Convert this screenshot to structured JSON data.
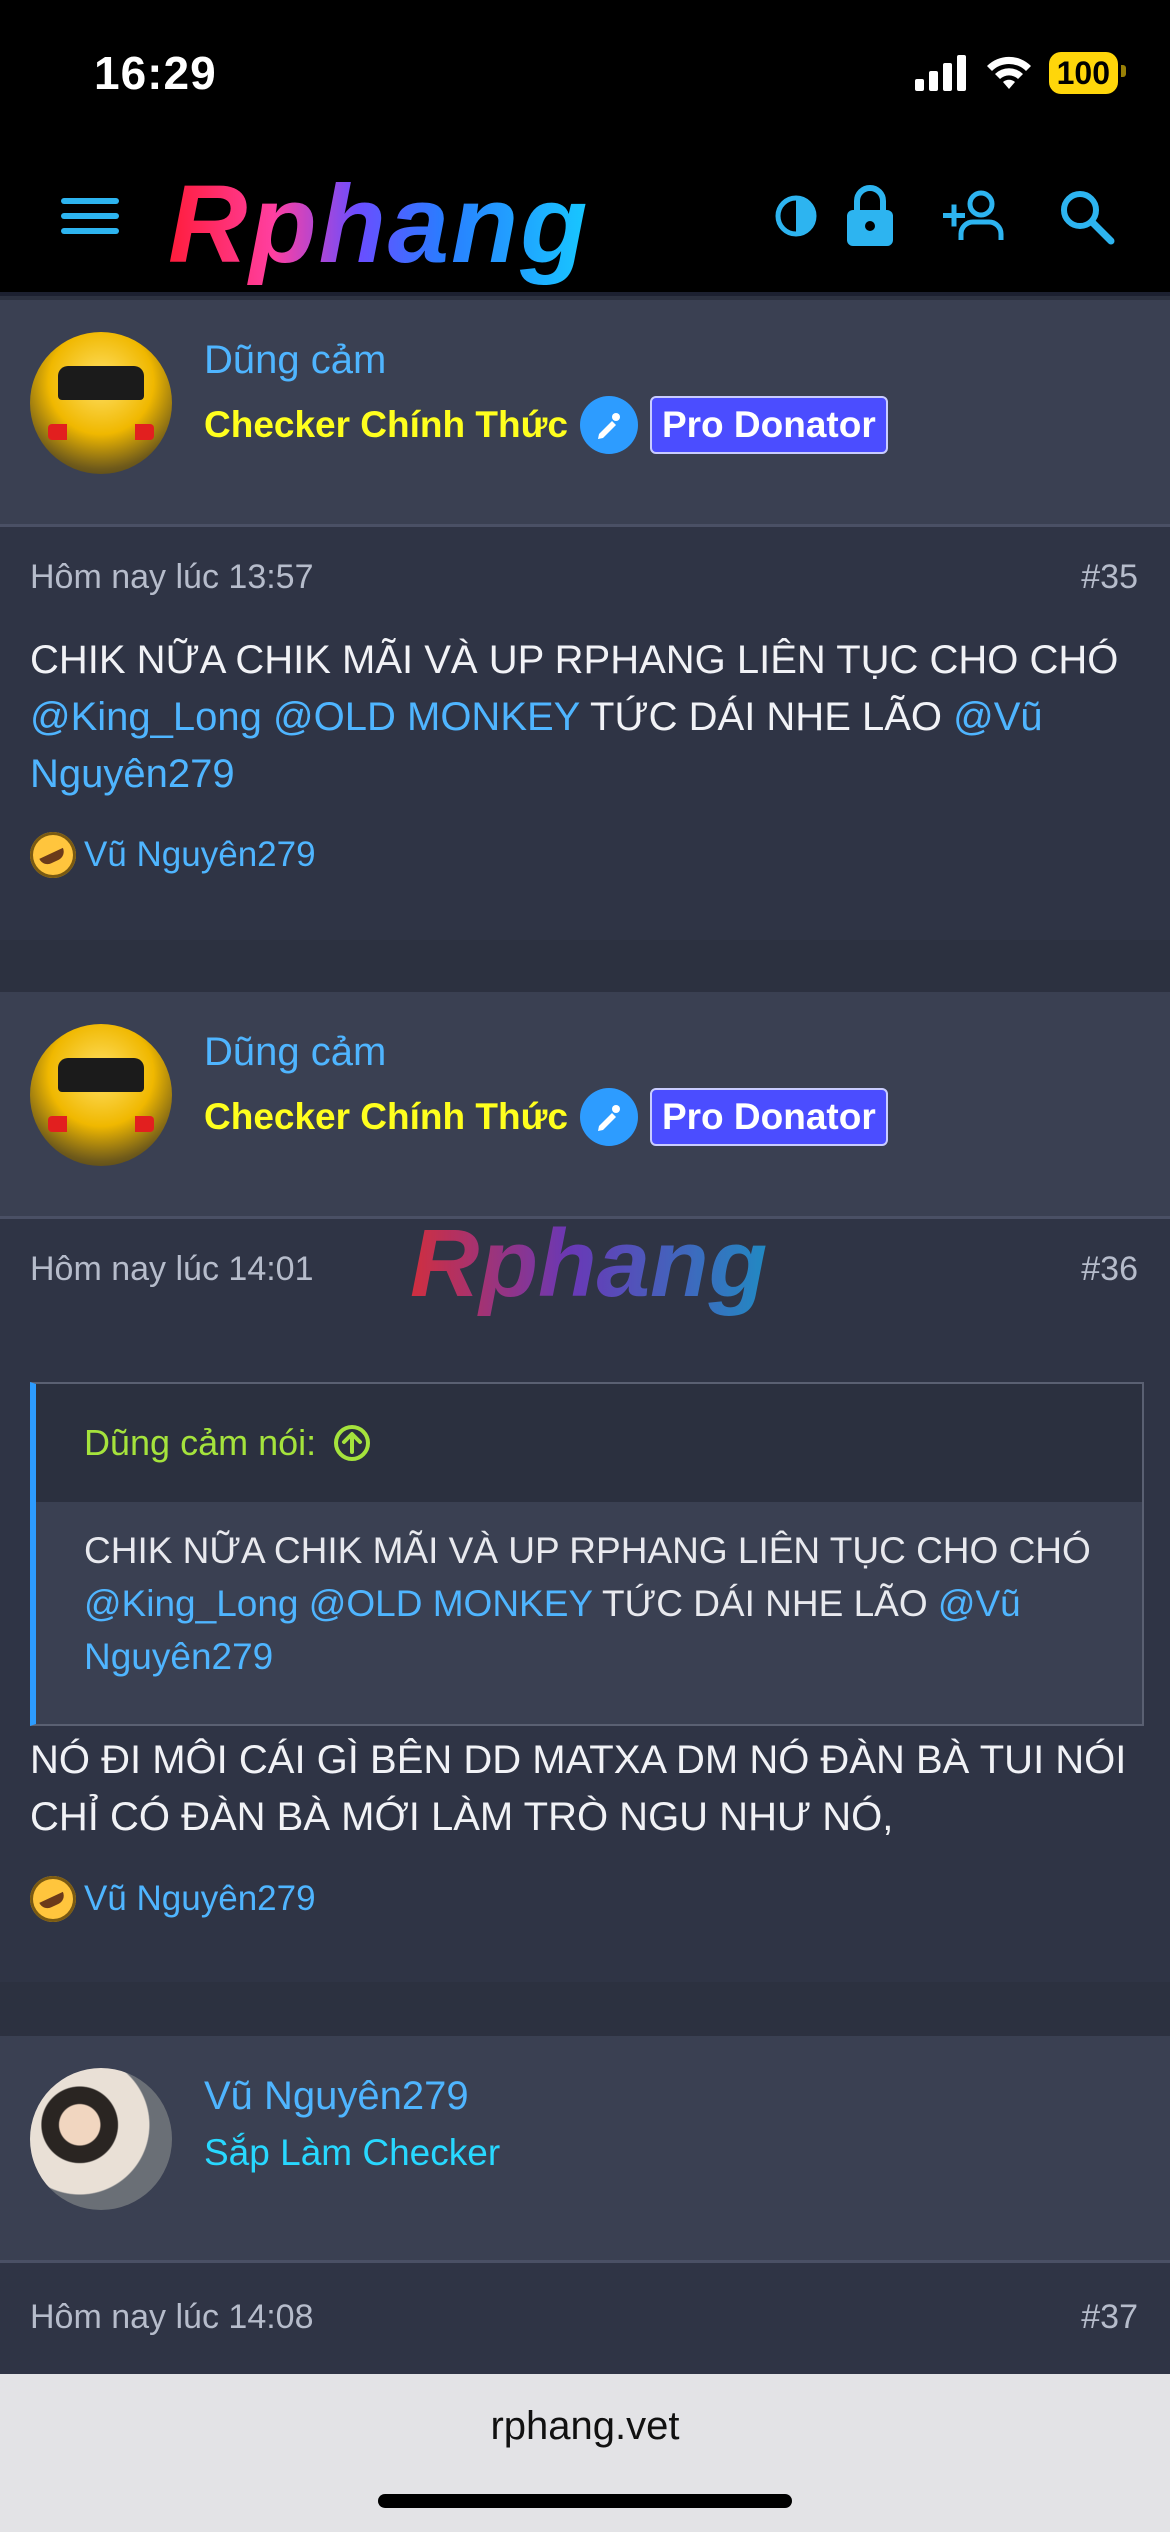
{
  "status": {
    "time": "16:29",
    "battery": "100"
  },
  "nav": {
    "logo": "Rphang"
  },
  "posts": [
    {
      "username": "Dũng cảm",
      "role": "Checker Chính Thức",
      "badge": "Pro Donator",
      "timestamp": "Hôm nay lúc 13:57",
      "number": "#35",
      "content": {
        "line1": "CHIK NỮA CHIK MÃI VÀ UP RPHANG LIÊN TỤC CHO CHÓ",
        "mention1": "@King_Long",
        "mention2": "@OLD MONKEY",
        "text2": " TỨC DÁI NHE LÃO ",
        "mention3": "@Vũ Nguyên279"
      },
      "reaction_user": "Vũ Nguyên279"
    },
    {
      "username": "Dũng cảm",
      "role": "Checker Chính Thức",
      "badge": "Pro Donator",
      "timestamp": "Hôm nay lúc 14:01",
      "number": "#36",
      "watermark": "Rphang",
      "quote": {
        "author": "Dũng cảm nói:",
        "line1": "CHIK NỮA CHIK MÃI VÀ UP RPHANG LIÊN TỤC CHO CHÓ",
        "mention1": "@King_Long",
        "mention2": "@OLD MONKEY",
        "text2": " TỨC DÁI NHE LÃO ",
        "mention3": "@Vũ Nguyên279"
      },
      "content": "NÓ ĐI MÔI CÁI GÌ BÊN DD MATXA DM NÓ ĐÀN BÀ TUI NÓI CHỈ CÓ ĐÀN BÀ MỚI LÀM TRÒ NGU NHƯ NÓ,",
      "reaction_user": "Vũ Nguyên279"
    },
    {
      "username": "Vũ Nguyên279",
      "role": "Sắp Làm Checker",
      "timestamp": "Hôm nay lúc 14:08",
      "number": "#37"
    }
  ],
  "browser": {
    "url": "rphang.vet"
  }
}
